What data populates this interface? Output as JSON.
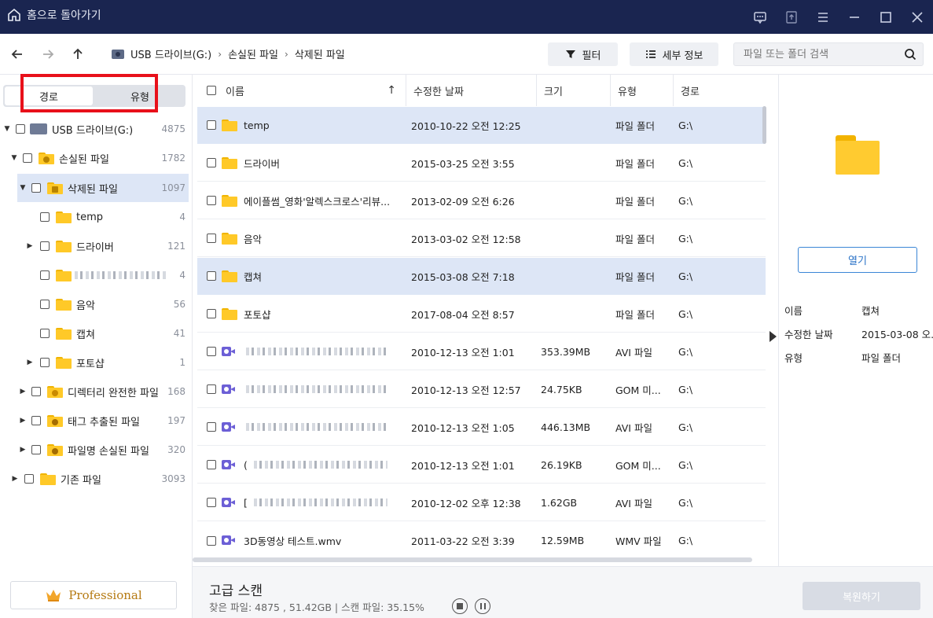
{
  "titlebar": {
    "home_label": "홈으로 돌아가기",
    "icons": [
      "feedback-icon",
      "upload-icon",
      "menu-icon",
      "minimize-icon",
      "maximize-icon",
      "close-icon"
    ]
  },
  "toolbar": {
    "breadcrumb": [
      "USB 드라이브(G:)",
      "손실된 파일",
      "삭제된 파일"
    ],
    "filter_label": "필터",
    "details_label": "세부 정보",
    "search_placeholder": "파일 또는 폴더 검색"
  },
  "sidebar": {
    "tab_path": "경로",
    "tab_type": "유형",
    "tree": [
      {
        "label": "USB 드라이브(G:)",
        "count": "4875"
      },
      {
        "label": "손실된 파일",
        "count": "1782"
      },
      {
        "label": "삭제된 파일",
        "count": "1097"
      },
      {
        "label": "temp",
        "count": "4"
      },
      {
        "label": "드라이버",
        "count": "121"
      },
      {
        "label": "",
        "count": "4"
      },
      {
        "label": "음악",
        "count": "56"
      },
      {
        "label": "캡쳐",
        "count": "41"
      },
      {
        "label": "포토샵",
        "count": "1"
      },
      {
        "label": "디렉터리 완전한 파일",
        "count": "168"
      },
      {
        "label": "태그 추출된 파일",
        "count": "197"
      },
      {
        "label": "파일명 손실된 파일",
        "count": "320"
      },
      {
        "label": "기존 파일",
        "count": "3093"
      }
    ],
    "professional_label": "Professional"
  },
  "list": {
    "headers": {
      "name": "이름",
      "modified": "수정한 날짜",
      "size": "크기",
      "type": "유형",
      "path": "경로"
    },
    "rows": [
      {
        "name": "temp",
        "date": "2010-10-22 오전 12:25",
        "size": "",
        "type": "파일 폴더",
        "path": "G:\\"
      },
      {
        "name": "드라이버",
        "date": "2015-03-25 오전 3:55",
        "size": "",
        "type": "파일 폴더",
        "path": "G:\\"
      },
      {
        "name": "에이플썸_영화'알렉스크로스'리뷰...",
        "date": "2013-02-09 오전 6:26",
        "size": "",
        "type": "파일 폴더",
        "path": "G:\\"
      },
      {
        "name": "음악",
        "date": "2013-03-02 오전 12:58",
        "size": "",
        "type": "파일 폴더",
        "path": "G:\\"
      },
      {
        "name": "캡쳐",
        "date": "2015-03-08 오전 7:18",
        "size": "",
        "type": "파일 폴더",
        "path": "G:\\"
      },
      {
        "name": "포토샵",
        "date": "2017-08-04 오전 8:57",
        "size": "",
        "type": "파일 폴더",
        "path": "G:\\"
      },
      {
        "name": "",
        "date": "2010-12-13 오전 1:01",
        "size": "353.39MB",
        "type": "AVI 파일",
        "path": "G:\\"
      },
      {
        "name": "",
        "date": "2010-12-13 오전 12:57",
        "size": "24.75KB",
        "type": "GOM 미...",
        "path": "G:\\"
      },
      {
        "name": "",
        "date": "2010-12-13 오전 1:05",
        "size": "446.13MB",
        "type": "AVI 파일",
        "path": "G:\\"
      },
      {
        "name": "(",
        "date": "2010-12-13 오전 1:01",
        "size": "26.19KB",
        "type": "GOM 미...",
        "path": "G:\\"
      },
      {
        "name": "[",
        "date": "2010-12-02 오후 12:38",
        "size": "1.62GB",
        "type": "AVI 파일",
        "path": "G:\\"
      },
      {
        "name": "3D동영상 테스트.wmv",
        "date": "2011-03-22 오전 3:39",
        "size": "12.59MB",
        "type": "WMV 파일",
        "path": "G:\\"
      }
    ]
  },
  "details": {
    "open_label": "열기",
    "name_label": "이름",
    "name_value": "캡쳐",
    "modified_label": "수정한 날짜",
    "modified_value": "2015-03-08 오...",
    "type_label": "유형",
    "type_value": "파일 폴더"
  },
  "status": {
    "title": "고급 스캔",
    "summary": "찾은 파일: 4875 , 51.42GB | 스캔 파일: 35.15%",
    "recover_label": "복원하기"
  }
}
